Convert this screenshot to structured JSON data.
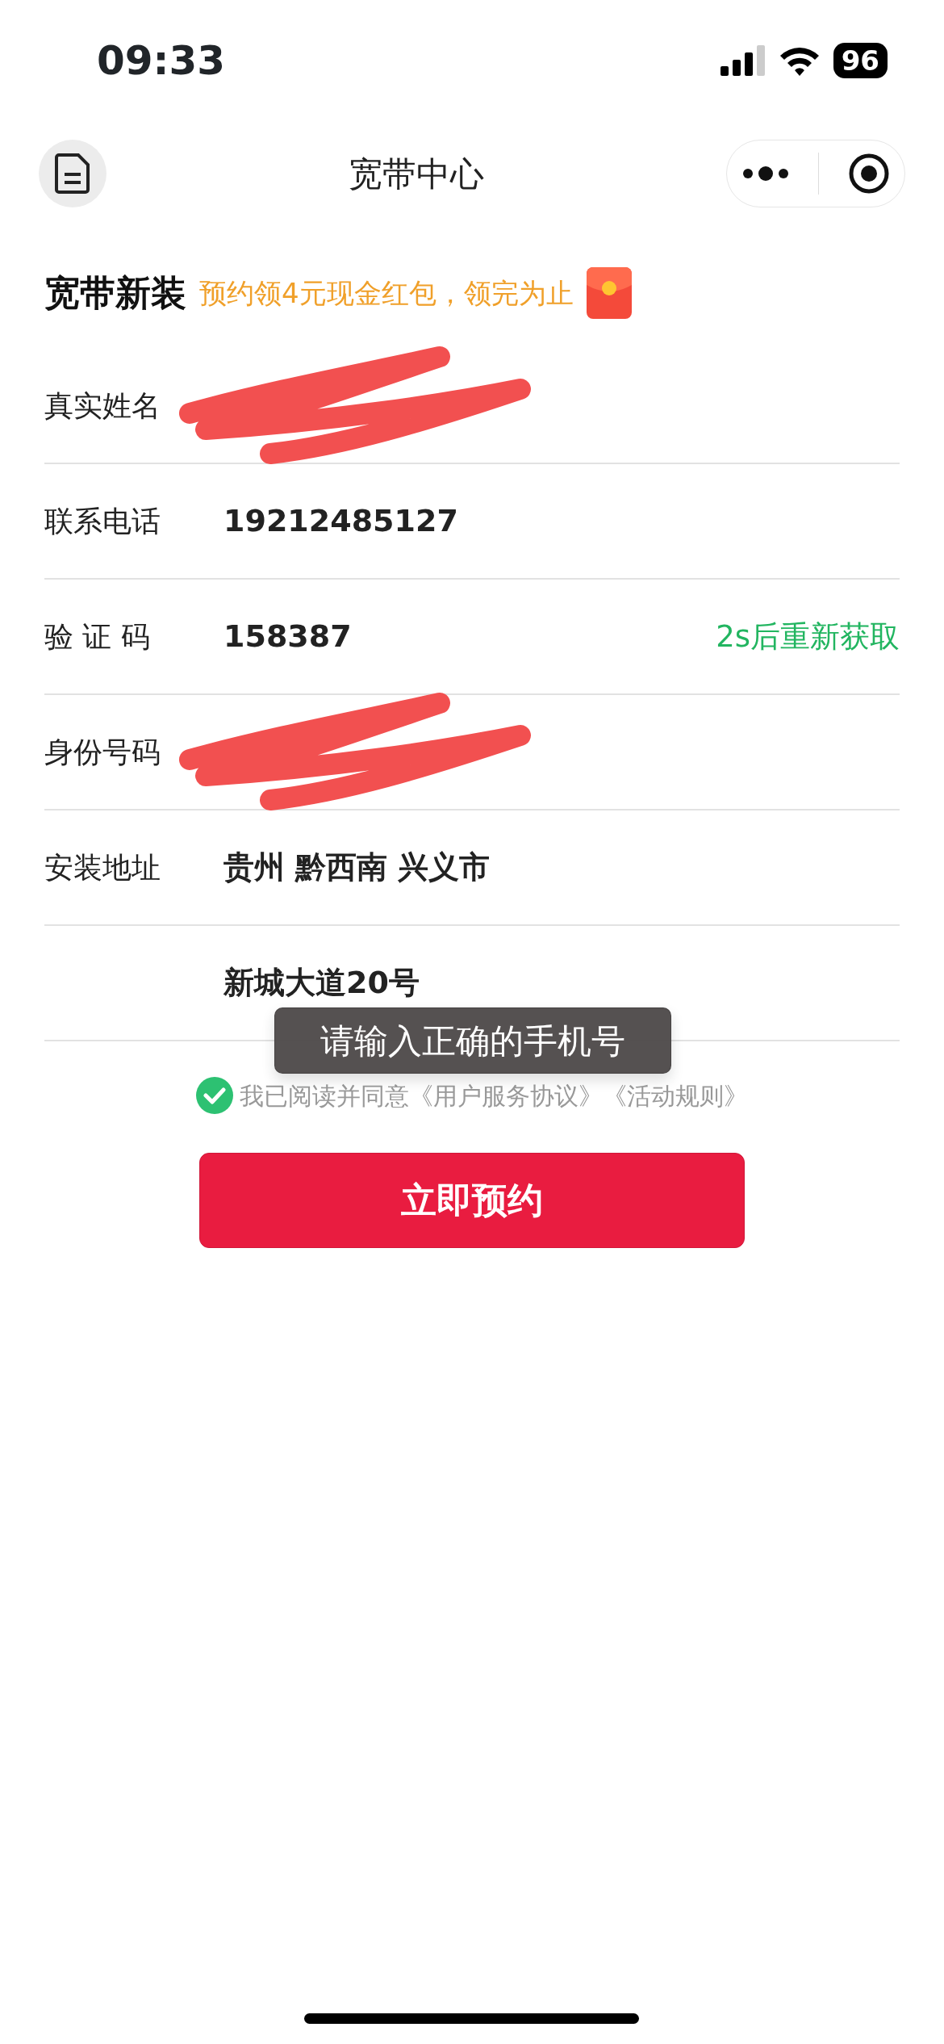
{
  "status_bar": {
    "time": "09:33",
    "battery": "96"
  },
  "nav": {
    "title": "宽带中心"
  },
  "section": {
    "title": "宽带新装",
    "promo": "预约领4元现金红包，领完为止"
  },
  "fields": [
    {
      "label": "真实姓名",
      "redacted": true
    },
    {
      "label": "联系电话",
      "value": "19212485127"
    },
    {
      "label": "验 证 码",
      "value": "158387",
      "action": "2s后重新获取"
    },
    {
      "label": "身份号码",
      "redacted": true
    },
    {
      "label": "安装地址",
      "value": "贵州 黔西南 兴义市"
    },
    {
      "value": "新城大道20号"
    }
  ],
  "agreement": {
    "checked": true,
    "text": "我已阅读并同意",
    "links": [
      "《用户服务协议》",
      "《活动规则》"
    ]
  },
  "submit": "立即预约",
  "toast": "请输入正确的手机号"
}
